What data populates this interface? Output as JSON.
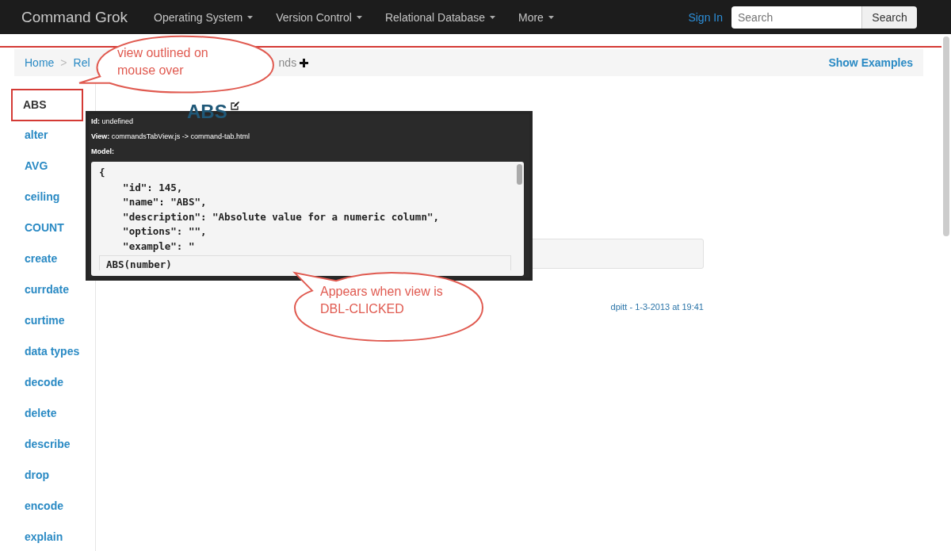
{
  "navbar": {
    "brand": "Command Grok",
    "menus": [
      {
        "label": "Operating System"
      },
      {
        "label": "Version Control"
      },
      {
        "label": "Relational Database"
      },
      {
        "label": "More"
      }
    ],
    "sign_in": "Sign In",
    "search": {
      "placeholder": "Search"
    },
    "search_button": "Search"
  },
  "breadcrumb": {
    "items": [
      {
        "text": "Home",
        "kind": "link"
      },
      {
        "text": ">",
        "kind": "separator"
      },
      {
        "text": "Rel",
        "kind": "link"
      },
      {
        "text": "nds",
        "kind": "current"
      }
    ],
    "show_examples": "Show Examples"
  },
  "sidebar": {
    "items": [
      {
        "label": "ABS",
        "selected": true,
        "outlined": true
      },
      {
        "label": "alter",
        "selected": false,
        "outlined": false
      },
      {
        "label": "AVG",
        "selected": false,
        "outlined": false
      },
      {
        "label": "ceiling",
        "selected": false,
        "outlined": false
      },
      {
        "label": "COUNT",
        "selected": false,
        "outlined": false
      },
      {
        "label": "create",
        "selected": false,
        "outlined": false
      },
      {
        "label": "currdate",
        "selected": false,
        "outlined": false
      },
      {
        "label": "curtime",
        "selected": false,
        "outlined": false
      },
      {
        "label": "data types",
        "selected": false,
        "outlined": false
      },
      {
        "label": "decode",
        "selected": false,
        "outlined": false
      },
      {
        "label": "delete",
        "selected": false,
        "outlined": false
      },
      {
        "label": "describe",
        "selected": false,
        "outlined": false
      },
      {
        "label": "drop",
        "selected": false,
        "outlined": false
      },
      {
        "label": "encode",
        "selected": false,
        "outlined": false
      },
      {
        "label": "explain",
        "selected": false,
        "outlined": false
      }
    ]
  },
  "command": {
    "name": "ABS",
    "footer": "dpitt - 1-3-2013 at 19:41"
  },
  "inspector": {
    "fields": [
      {
        "label": "Id:",
        "value": "undefined"
      },
      {
        "label": "View:",
        "value": "commandsTabView.js -> command-tab.html"
      },
      {
        "label": "Model:"
      }
    ],
    "model_lines": [
      "{",
      "    \"id\": 145,",
      "    \"name\": \"ABS\",",
      "    \"description\": \"Absolute value for a numeric column\",",
      "    \"options\": \"\",",
      "    \"example\": \""
    ],
    "model_example": "ABS(number)"
  },
  "callouts": [
    {
      "text": "view outlined on mouse over",
      "kind": "top"
    },
    {
      "text": "Appears when view is DBL-CLICKED",
      "kind": "bottom"
    }
  ]
}
